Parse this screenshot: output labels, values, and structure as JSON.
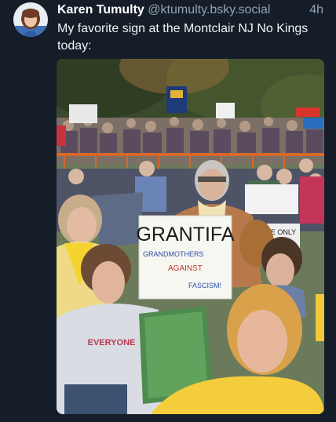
{
  "post": {
    "author_name": "Karen Tumulty",
    "author_handle": "@ktumulty.bsky.social",
    "timestamp": "4h",
    "text": "My favorite sign at the Montclair NJ No Kings today:"
  },
  "photo": {
    "sign_main": "GRANTIFA",
    "sign_line1": "GRANDMOTHERS",
    "sign_line2": "AGAINST",
    "sign_line3": "FASCISM!",
    "shirt_text": "EVERYONE",
    "small_sign_text": "E ONLY"
  },
  "colors": {
    "background": "#151d28",
    "handle": "#93a3b5",
    "sign_red": "#c0392b",
    "sign_blue": "#2c4fa8"
  }
}
